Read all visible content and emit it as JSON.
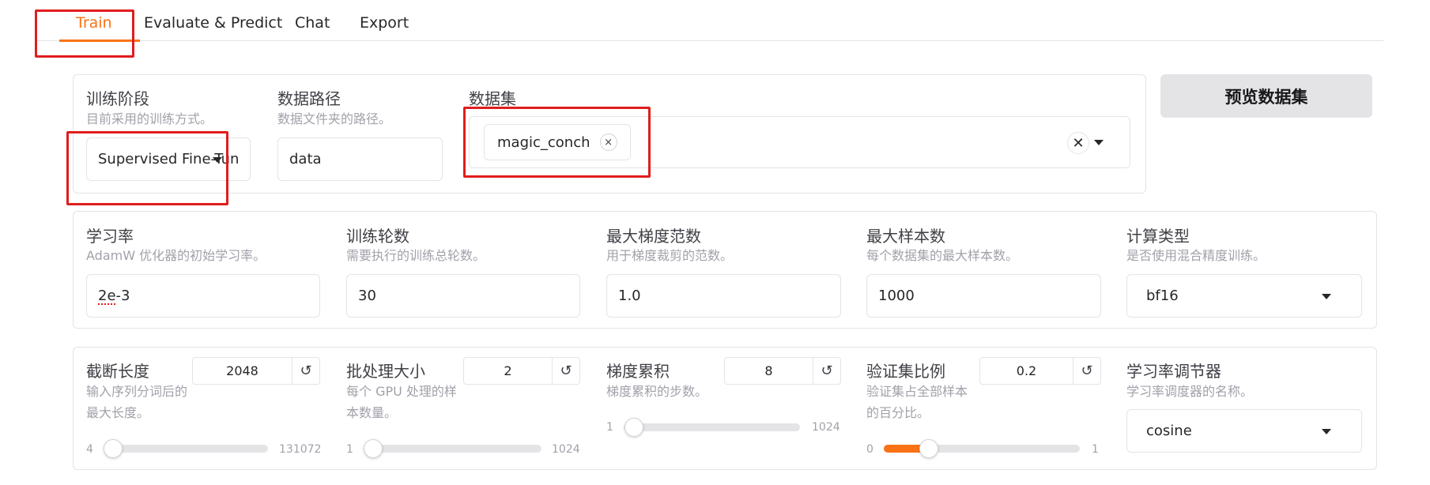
{
  "tabs": [
    {
      "label": "Train",
      "active": true
    },
    {
      "label": "Evaluate & Predict"
    },
    {
      "label": "Chat"
    },
    {
      "label": "Export"
    }
  ],
  "stage": {
    "label": "训练阶段",
    "info": "目前采用的训练方式。",
    "value": "Supervised Fine-Tun"
  },
  "data_path": {
    "label": "数据路径",
    "info": "数据文件夹的路径。",
    "value": "data"
  },
  "dataset": {
    "label": "数据集",
    "selected": [
      "magic_conch"
    ],
    "chip_remove": "×",
    "clear": "✕"
  },
  "preview_button": "预览数据集",
  "row2": {
    "learning_rate": {
      "label": "学习率",
      "info": "AdamW 优化器的初始学习率。",
      "value": "2e-3"
    },
    "epochs": {
      "label": "训练轮数",
      "info": "需要执行的训练总轮数。",
      "value": "30"
    },
    "max_grad_norm": {
      "label": "最大梯度范数",
      "info": "用于梯度裁剪的范数。",
      "value": "1.0"
    },
    "max_samples": {
      "label": "最大样本数",
      "info": "每个数据集的最大样本数。",
      "value": "1000"
    },
    "compute_type": {
      "label": "计算类型",
      "info": "是否使用混合精度训练。",
      "value": "bf16"
    }
  },
  "row3": {
    "cutoff_len": {
      "label": "截断长度",
      "info_line1": "输入序列分词后的",
      "info_line2": "最大长度。",
      "value": "2048",
      "min": "4",
      "max": "131072",
      "level": 0.0
    },
    "batch_size": {
      "label": "批处理大小",
      "info_line1": "每个 GPU 处理的样",
      "info_line2": "本数量。",
      "value": "2",
      "min": "1",
      "max": "1024",
      "level": 0.001
    },
    "grad_accum": {
      "label": "梯度累积",
      "info": "梯度累积的步数。",
      "value": "8",
      "min": "1",
      "max": "1024",
      "level": 0.007
    },
    "val_size": {
      "label": "验证集比例",
      "info_line1": "验证集占全部样本",
      "info_line2": "的百分比。",
      "value": "0.2",
      "min": "0",
      "max": "1",
      "level": 0.2
    },
    "scheduler": {
      "label": "学习率调节器",
      "info": "学习率调度器的名称。",
      "value": "cosine"
    }
  },
  "reset_icon": "↺",
  "colors": {
    "accent": "#f97316",
    "highlight": "#e11d1d"
  }
}
